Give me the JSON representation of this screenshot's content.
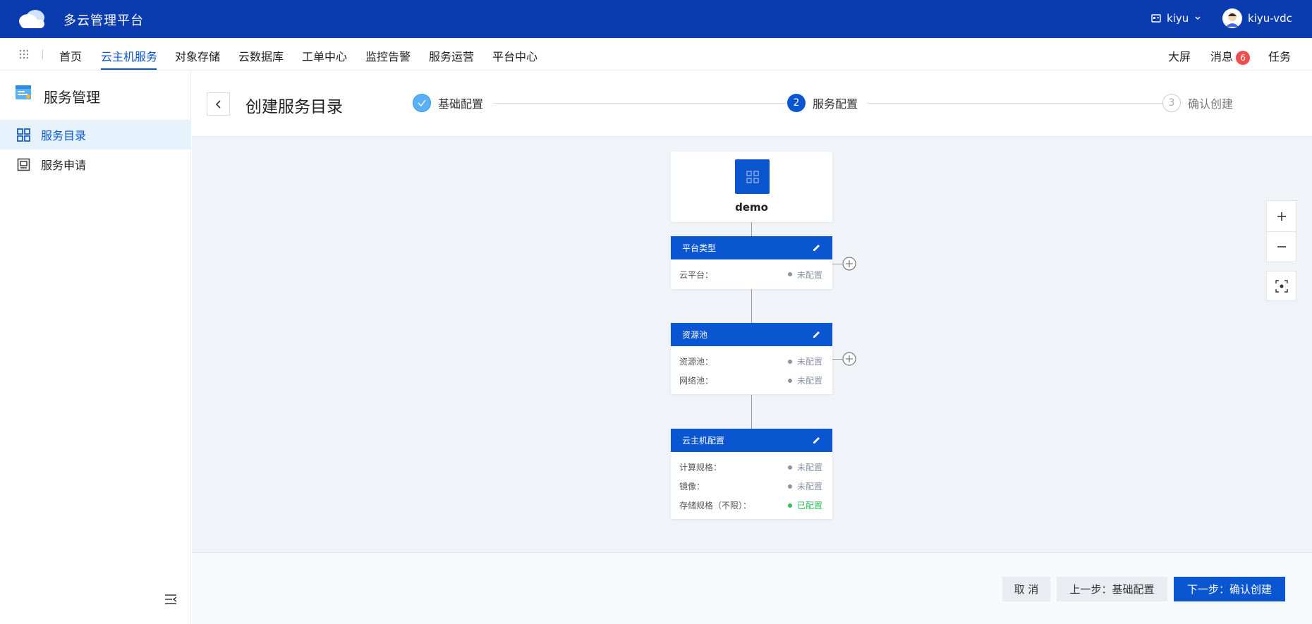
{
  "app": {
    "title": "多云管理平台"
  },
  "topbar": {
    "tenant": "kiyu",
    "user": "kiyu-vdc"
  },
  "nav": {
    "items": [
      "首页",
      "云主机服务",
      "对象存储",
      "云数据库",
      "工单中心",
      "监控告警",
      "服务运营",
      "平台中心"
    ],
    "active_index": 1,
    "right": {
      "screen": "大屏",
      "messages": "消息",
      "message_count": "6",
      "tasks": "任务"
    }
  },
  "sidebar": {
    "title": "服务管理",
    "items": [
      {
        "label": "服务目录",
        "active": true
      },
      {
        "label": "服务申请",
        "active": false
      }
    ]
  },
  "header": {
    "title": "创建服务目录",
    "steps": [
      {
        "index": "1",
        "label": "基础配置",
        "status": "done"
      },
      {
        "index": "2",
        "label": "服务配置",
        "status": "current"
      },
      {
        "index": "3",
        "label": "确认创建",
        "status": "pending"
      }
    ]
  },
  "flow": {
    "root": {
      "label": "demo"
    },
    "cards": [
      {
        "title": "平台类型",
        "rows": [
          {
            "label": "云平台：",
            "status": "未配置"
          }
        ]
      },
      {
        "title": "资源池",
        "rows": [
          {
            "label": "资源池：",
            "status": "未配置"
          },
          {
            "label": "网络池：",
            "status": "未配置"
          }
        ]
      },
      {
        "title": "云主机配置",
        "rows": [
          {
            "label": "计算规格：",
            "status": "未配置"
          },
          {
            "label": "镜像：",
            "status": "未配置"
          },
          {
            "label": "存储规格（不限）：",
            "status": "已配置"
          }
        ]
      }
    ]
  },
  "footer": {
    "cancel": "取 消",
    "prev": "上一步：基础配置",
    "next": "下一步：确认创建"
  },
  "colors": {
    "primary": "#0a55d0",
    "topbar": "#0a3cb0",
    "success": "#2fbf5a",
    "badge": "#f04d4d"
  }
}
